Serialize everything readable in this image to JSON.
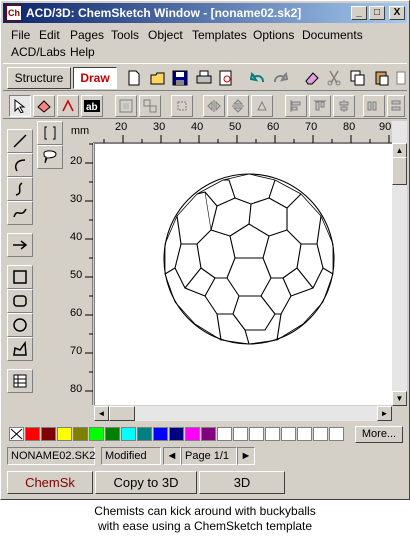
{
  "window": {
    "title": "ACD/3D: ChemSketch Window - [noname02.sk2]",
    "app_icon": "chemsketch-logo-icon",
    "controls": {
      "minimize": "_",
      "restore": "□",
      "close": "X"
    }
  },
  "menu": {
    "items": [
      "File",
      "Edit",
      "Pages",
      "Tools",
      "Object",
      "Templates",
      "Options",
      "Documents",
      "ACD/Labs",
      "Help"
    ]
  },
  "mode_tabs": {
    "structure": "Structure",
    "draw": "Draw"
  },
  "toolbar1_icons": [
    "new-page-icon",
    "open-icon",
    "save-icon",
    "print-icon",
    "print-preview-icon",
    "undo-icon",
    "redo-icon",
    "eraser-icon",
    "cut-icon",
    "copy-icon",
    "paste-icon"
  ],
  "toolbar2_icons": [
    "select-arrow-icon",
    "select-lasso-icon",
    "rotate-select-icon",
    "text-ab-icon",
    "group-icon",
    "ungroup-icon",
    "arrange-icon",
    "flip-horizontal-icon",
    "flip-vertical-icon",
    "rotate-icon",
    "align-left-icon",
    "align-top-icon",
    "align-center-icon",
    "distribute-icon"
  ],
  "draw_tools": [
    "line-tool-icon",
    "bracket-tool-icon",
    "arc-tool-icon",
    "callout-tool-icon",
    "curve-tool-icon",
    "wave-tool-icon",
    "arrow-tool-icon",
    "rectangle-tool-icon",
    "rounded-rect-tool-icon",
    "ellipse-tool-icon",
    "polygon-tool-icon",
    "table-tool-icon"
  ],
  "ruler": {
    "unit": "mm",
    "h_ticks": [
      "20",
      "30",
      "40",
      "50",
      "60",
      "70",
      "80",
      "90"
    ],
    "v_ticks": [
      "20",
      "30",
      "40",
      "50",
      "60",
      "70",
      "80"
    ]
  },
  "palette": {
    "colors": [
      "#ffffff",
      "#ff0000",
      "#800000",
      "#ffff00",
      "#808000",
      "#00ff00",
      "#008000",
      "#00ffff",
      "#008080",
      "#0000ff",
      "#000080",
      "#ff00ff",
      "#800080",
      "#ffffff",
      "#ffffff",
      "#ffffff",
      "#ffffff",
      "#ffffff",
      "#ffffff",
      "#ffffff",
      "#ffffff"
    ],
    "more_label": "More..."
  },
  "status": {
    "filename": "NONAME02.SK2",
    "state": "Modified",
    "page": "Page 1/1"
  },
  "bottom_buttons": {
    "chemsk": "ChemSk",
    "copy3d": "Copy to 3D",
    "threed": "3D"
  },
  "caption": {
    "line1": "Chemists can kick around with buckyballs",
    "line2": "with ease using a ChemSketch template"
  }
}
